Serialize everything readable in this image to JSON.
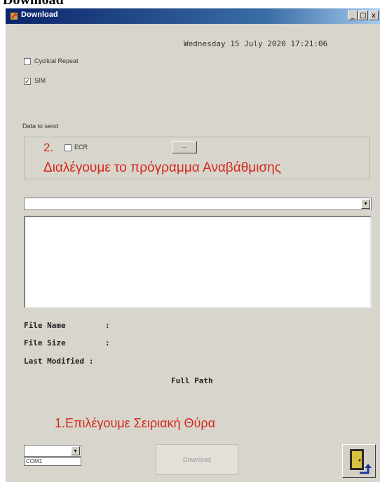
{
  "page_heading_fragment": "Download",
  "window": {
    "title": "Download",
    "min_glyph": "_",
    "max_glyph": "□",
    "close_glyph": "x"
  },
  "datetime": "Wednesday 15 July 2020  17:21:06",
  "options": {
    "cyclical_repeat": {
      "label": "Cyclical Repeat",
      "checked": false
    },
    "sim": {
      "label": "SIM",
      "checked": true,
      "check_glyph": "✓"
    }
  },
  "data_to_send": {
    "label": "Data to send",
    "step_number": "2.",
    "ecr_label": "ECR",
    "ecr_checked": false,
    "browse_label": "...",
    "instruction": "Διαλέγουμε το πρόγραμμα Αναβάθμισης"
  },
  "file_select": {
    "value": "",
    "arrow_glyph": "▾"
  },
  "file_info": {
    "name_label": "File Name",
    "name_sep": ":",
    "size_label": "File Size",
    "size_sep": ":",
    "modified_label": "Last Modified :",
    "full_path_label": "Full Path"
  },
  "instruction_port": "1.Επιλέγουμε Σειριακή Θύρα",
  "port": {
    "selected": "",
    "value": "COM1",
    "arrow_glyph": "▾"
  },
  "download_button": "Download",
  "icons": {
    "app": "app-icon",
    "exit": "exit-door-icon"
  },
  "colors": {
    "instruction_red": "#d42a1c",
    "titlebar_start": "#0a246a",
    "titlebar_end": "#a6caf0",
    "window_bg": "#d8d5cd"
  }
}
